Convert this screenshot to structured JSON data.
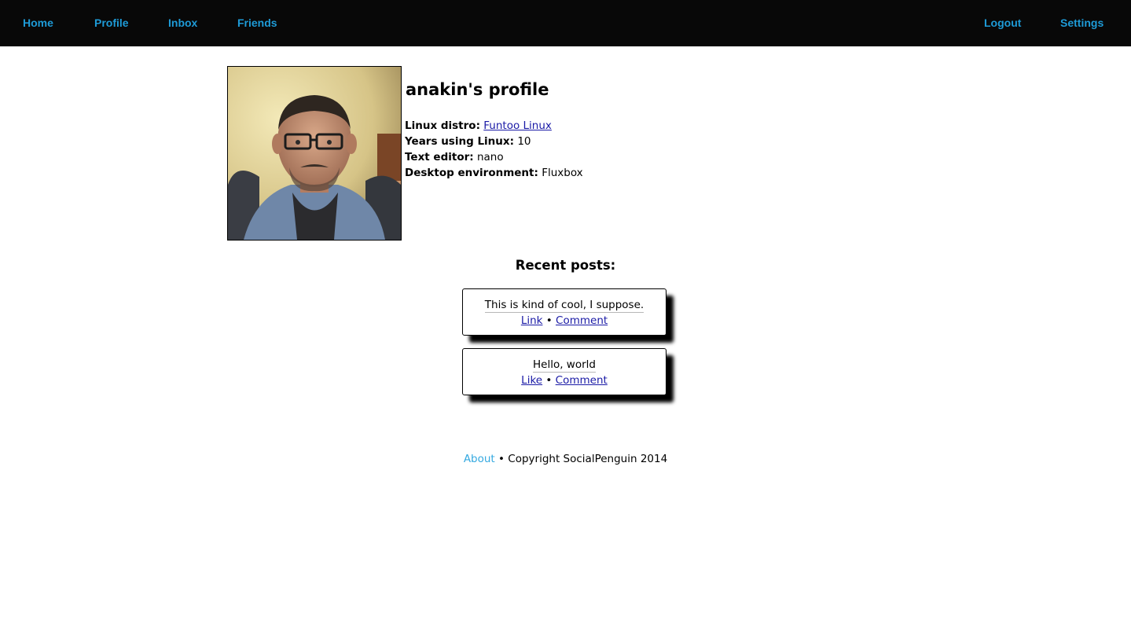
{
  "nav": {
    "home": "Home",
    "profile": "Profile",
    "inbox": "Inbox",
    "friends": "Friends",
    "logout": "Logout",
    "settings": "Settings"
  },
  "profile": {
    "title": "anakin's profile",
    "fields": [
      {
        "label": "Linux distro:",
        "value": "Funtoo Linux",
        "is_link": true
      },
      {
        "label": "Years using Linux:",
        "value": "10"
      },
      {
        "label": "Text editor:",
        "value": "nano"
      },
      {
        "label": "Desktop environment:",
        "value": "Fluxbox"
      }
    ]
  },
  "recent": {
    "title": "Recent posts:",
    "posts": [
      {
        "text": "This is kind of cool, I suppose.",
        "action1": "Link",
        "separator": "•",
        "action2": "Comment"
      },
      {
        "text": "Hello, world",
        "action1": "Like",
        "separator": "•",
        "action2": "Comment"
      }
    ]
  },
  "footer": {
    "about": "About",
    "separator": "•",
    "copyright": "Copyright SocialPenguin 2014"
  },
  "colors": {
    "nav_bg": "#080808",
    "nav_link": "#1e9bd7",
    "footer_link": "#35a9e0",
    "content_link": "#1a1aa6"
  }
}
